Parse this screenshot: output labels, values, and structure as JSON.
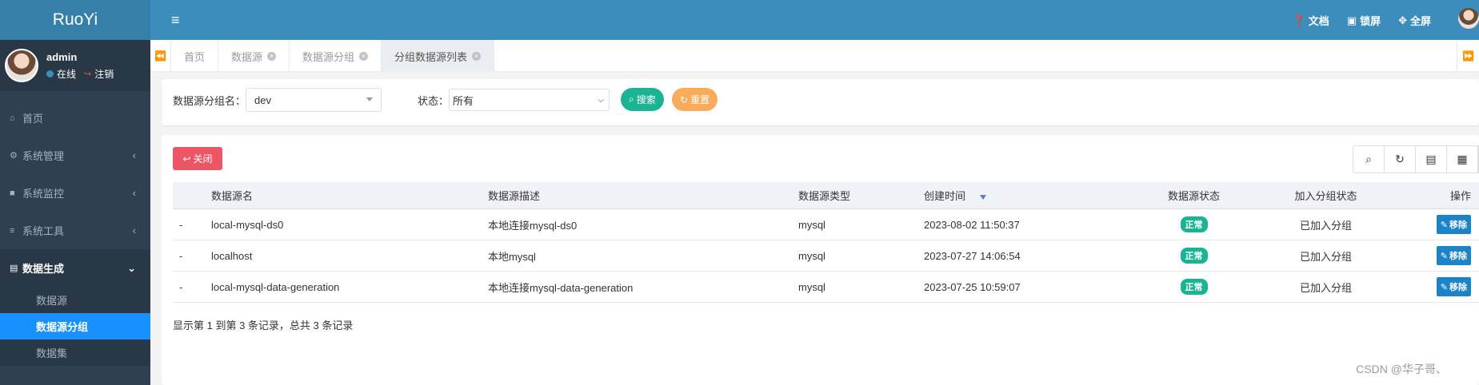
{
  "app": {
    "logo": "RuoYi"
  },
  "user": {
    "name": "admin",
    "online": "在线",
    "logout": "注销"
  },
  "sidebar": {
    "items": [
      {
        "label": "首页",
        "icon": "home-icon"
      },
      {
        "label": "系统管理",
        "icon": "gear-icon"
      },
      {
        "label": "系统监控",
        "icon": "video-icon"
      },
      {
        "label": "系统工具",
        "icon": "bars-icon"
      },
      {
        "label": "数据生成",
        "icon": "database-icon"
      }
    ],
    "submenu": [
      {
        "label": "数据源"
      },
      {
        "label": "数据源分组"
      },
      {
        "label": "数据集"
      }
    ]
  },
  "navbar": {
    "docs": "文档",
    "lock": "锁屏",
    "fullscreen": "全屏"
  },
  "tabs": [
    {
      "label": "首页"
    },
    {
      "label": "数据源"
    },
    {
      "label": "数据源分组"
    },
    {
      "label": "分组数据源列表"
    }
  ],
  "search": {
    "group_label": "数据源分组名：",
    "group_value": "dev",
    "status_label": "状态：",
    "status_value": "所有",
    "search_btn": "搜索",
    "reset_btn": "重置"
  },
  "table": {
    "close_btn": "关闭",
    "columns": [
      "数据源名",
      "数据源描述",
      "数据源类型",
      "创建时间",
      "数据源状态",
      "加入分组状态",
      "操作"
    ],
    "rows": [
      {
        "expand": "-",
        "name": "local-mysql-ds0",
        "desc": "本地连接mysql-ds0",
        "type": "mysql",
        "created": "2023-08-02 11:50:37",
        "status": "正常",
        "group_status": "已加入分组",
        "action": "移除"
      },
      {
        "expand": "-",
        "name": "localhost",
        "desc": "本地mysql",
        "type": "mysql",
        "created": "2023-07-27 14:06:54",
        "status": "正常",
        "group_status": "已加入分组",
        "action": "移除"
      },
      {
        "expand": "-",
        "name": "local-mysql-data-generation",
        "desc": "本地连接mysql-data-generation",
        "type": "mysql",
        "created": "2023-07-25 10:59:07",
        "status": "正常",
        "group_status": "已加入分组",
        "action": "移除"
      }
    ],
    "pagination": "显示第 1 到第 3 条记录，总共 3 条记录"
  },
  "watermark": "CSDN @华子哥、",
  "colors": {
    "sidebar": "#2f4050",
    "navbar": "#3c8dbc",
    "selected": "#1890ff",
    "success": "#1ab394",
    "warning": "#f8ac59",
    "danger": "#ed5565",
    "primary": "#1c84c6"
  }
}
